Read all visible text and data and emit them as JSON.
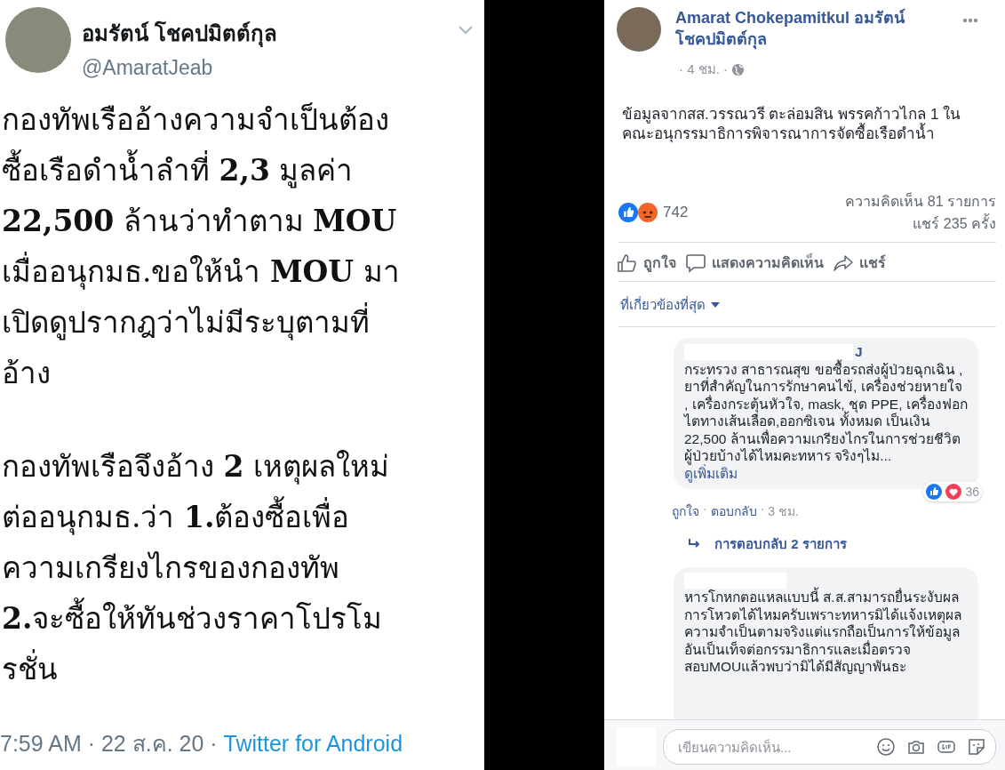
{
  "tweet": {
    "author_name": "อมรัตน์ โชคปมิตต์กุล",
    "handle": "@AmaratJeab",
    "paragraphs": [
      "กองทัพเรืออ้างความจำเป็นต้อง\nซื้อเรือดำน้ำลำที่ **2,3** มูลค่า\n**22,500** ล้านว่าทำตาม **MOU**\nเมื่ออนุกมธ.ขอให้นำ **MOU** มา\nเปิดดูปรากฎว่าไม่มีระบุตามที่\nอ้าง",
      "กองทัพเรือจึงอ้าง **2** เหตุผลใหม่\nต่ออนุกมธ.ว่า **1.**ต้องซื้อเพื่อ\nความเกรียงไกรของกองทัพ\n**2.**จะซื้อให้ทันช่วงราคาโปรโม\nรชั่น"
    ],
    "timestamp": "7:59 AM · 22 ส.ค. 20 ·",
    "source": "Twitter for Android"
  },
  "facebook_post": {
    "author_name": "Amarat Chokepamitkul อมรัตน์ โชคปมิตต์กุล",
    "time": "· 4 ชม. ·",
    "text": "ข้อมูลจากสส.วรรณวรี ตะล่อมสิน พรรคก้าวไกล 1 ในคณะอนุกรรมาธิการพิจารณาการจัดซื้อเรือดำน้ำ",
    "reaction_count": "742",
    "comments_count": "ความคิดเห็น 81 รายการ",
    "shares_count": "แชร์ 235 ครั้ง",
    "actions": [
      {
        "kind": "like",
        "label": "ถูกใจ"
      },
      {
        "kind": "comment",
        "label": "แสดงความคิดเห็น"
      },
      {
        "kind": "share",
        "label": "แชร์"
      }
    ],
    "sort_label": "ที่เกี่ยวข้องที่สุด",
    "comments": [
      {
        "author": "J",
        "text": "กระทรวง สาธารณสุข ขอซื้อรถส่งผู้ป่วยฉุกเฉิน , ยาที่สำคัญในการรักษาคนไข้, เครื่องช่วยหายใจ , เครื่องกระตุ้นหัวใจ, mask, ชุด PPE, เครื่องฟอกไตทางเส้นเลือด,ออกซิเจน ทั้งหมด เป็นเงิน 22,500 ล้านเพื่อความเกรียงไกรในการช่วยชีวิตผู้ป่วยบ้างได้ไหมคะทหาร จริงๆไม...",
        "see_more": "ดูเพิ่มเติม",
        "reaction_count": "36",
        "like": "ถูกใจ",
        "separator": "·",
        "reply": "ตอบกลับ",
        "time": "3 ชม.",
        "replies": "การตอบกลับ 2 รายการ"
      },
      {
        "text": "หารโกหกตอแหลแบบนี้ ส.ส.สามารถยื่นระงับผลการโหวตได้ไหมครับเพราะทหารมิได้แจ้งเหตุผลความจำเป็นตามจริงแต่แรกถือเป็นการให้ข้อมูลอันเป็นเท็จต่อกรรมาธิการและเมื่อตรวจสอบMOUแล้วพบว่ามิได้มีสัญญาพันธะ"
      }
    ],
    "composer": {
      "placeholder": "เขียนความคิดเห็น..."
    }
  }
}
